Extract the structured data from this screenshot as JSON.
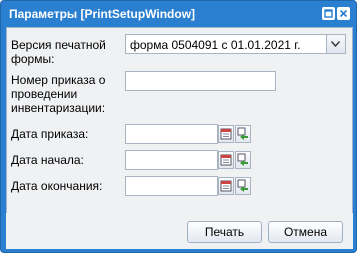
{
  "window": {
    "title": "Параметры [PrintSetupWindow]",
    "tools": [
      "restore-icon",
      "close-icon"
    ]
  },
  "form": {
    "print_form_label": "Версия печатной формы:",
    "print_form_value": "форма 0504091 с 01.01.2021 г.",
    "order_number_label": "Номер приказа о проведении инвентаризации:",
    "order_number_value": "",
    "order_date_label": "Дата приказа:",
    "order_date_value": "",
    "start_date_label": "Дата начала:",
    "start_date_value": "",
    "end_date_label": "Дата окончания:",
    "end_date_value": ""
  },
  "buttons": {
    "print_label": "Печать",
    "cancel_label": "Отмена"
  },
  "colors": {
    "titlebar": "#2a7fd1",
    "panel": "#f0f1f3"
  }
}
